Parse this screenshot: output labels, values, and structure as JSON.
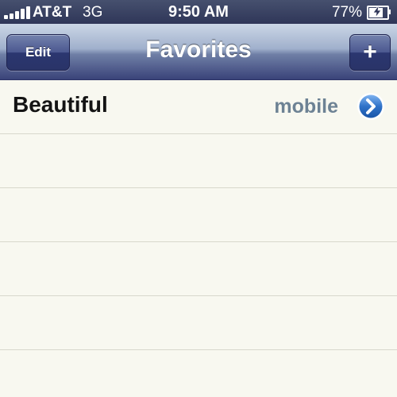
{
  "status_bar": {
    "carrier": "AT&T",
    "network": "3G",
    "time": "9:50 AM",
    "battery_percent": "77%",
    "battery_level": 0.77,
    "signal_bars": 5
  },
  "nav": {
    "title": "Favorites",
    "edit_label": "Edit",
    "add_label": "+"
  },
  "favorites": [
    {
      "name": "Beautiful",
      "label": "mobile"
    }
  ],
  "colors": {
    "status_bar": "#2f3658",
    "nav_bar_bottom": "#3a4379",
    "row_label": "#6d8294",
    "disclosure": "#2f72c8",
    "background": "#f8f8f0"
  }
}
